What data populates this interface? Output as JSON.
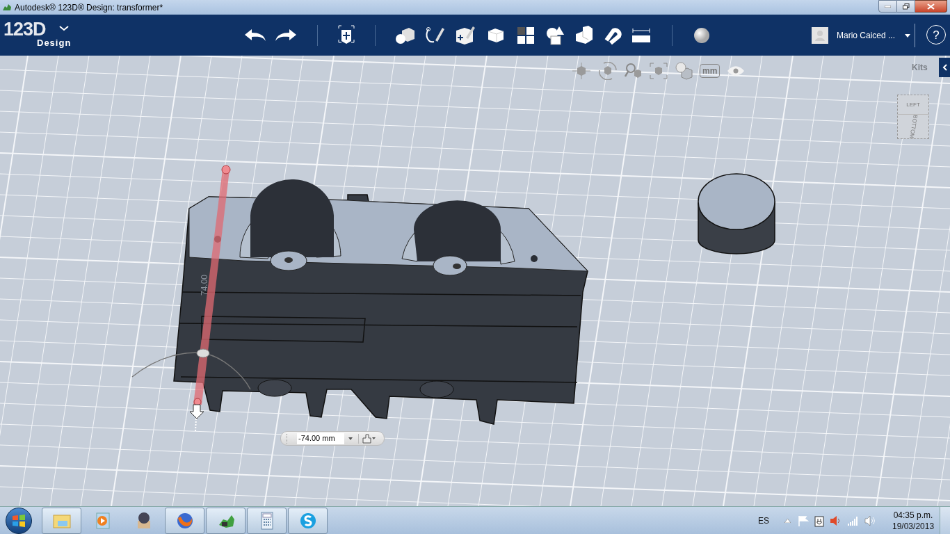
{
  "window": {
    "title": "Autodesk® 123D® Design: transformer*"
  },
  "app_menu": {
    "logo": "123D",
    "subtitle": "Design"
  },
  "toolbar": {
    "user_name": "Mario Caiced ...",
    "help_button": "?"
  },
  "viewport": {
    "kits_label": "Kits",
    "unit_button": "mm",
    "view_cube": {
      "top_face": "LEFT",
      "side_face": "BOTTOM"
    },
    "model_dimension": "74.00",
    "distance_field": {
      "value": "-74.00 mm"
    }
  },
  "taskbar": {
    "items": [
      {
        "kind": "explorer",
        "running": true
      },
      {
        "kind": "media",
        "running": false
      },
      {
        "kind": "package",
        "running": false
      },
      {
        "kind": "browser",
        "running": true
      },
      {
        "kind": "cad",
        "running": true
      },
      {
        "kind": "calculator",
        "running": true
      },
      {
        "kind": "chat",
        "running": true
      }
    ],
    "language": "ES",
    "time": "04:35 p.m.",
    "date": "19/03/2013"
  }
}
